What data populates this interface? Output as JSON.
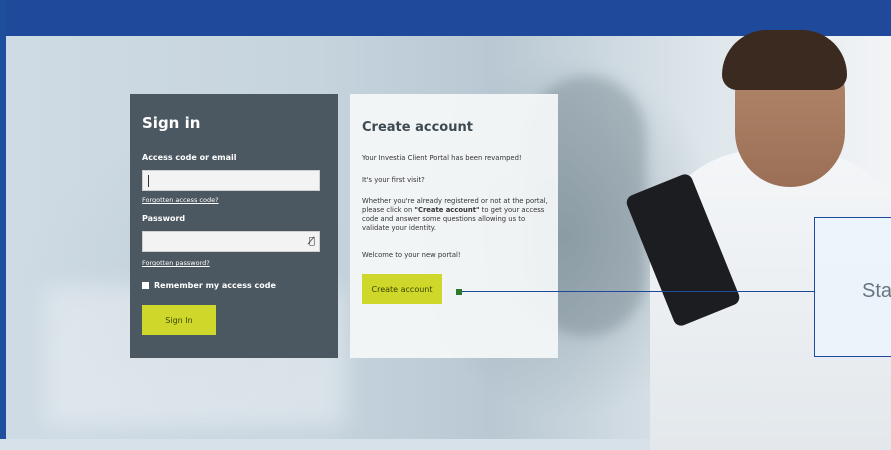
{
  "signin": {
    "title": "Sign in",
    "access_label": "Access code or email",
    "access_value": "",
    "forgot_access": "Forgotten access code?",
    "password_label": "Password",
    "password_value": "",
    "show_password_icon": "eye-slash-icon",
    "forgot_password": "Forgotten password?",
    "remember_label": "Remember my access code",
    "signin_button": "Sign In"
  },
  "create": {
    "title": "Create account",
    "p1": "Your Investia Client Portal has been revamped!",
    "p2": "It's your first visit?",
    "p3_before": "Whether you're already registered or not at the portal, please click on ",
    "p3_bold": "\"Create account\"",
    "p3_after": " to get your access code and answer some questions allowing us to validate your identity.",
    "p4": "Welcome to your new portal!",
    "button": "Create account"
  },
  "callout": {
    "text": "Sta"
  },
  "colors": {
    "topbar": "#1f4a9b",
    "signin_panel": "#4c5861",
    "accent_button": "#cfd82a"
  }
}
